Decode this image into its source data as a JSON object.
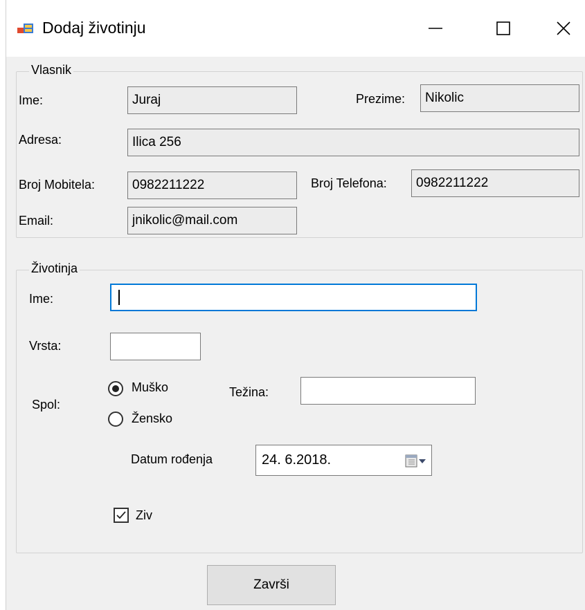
{
  "window": {
    "title": "Dodaj životinju",
    "icon": "winforms-app-icon",
    "controls": {
      "minimize_icon": "minimize-icon",
      "maximize_icon": "maximize-icon",
      "close_icon": "close-icon"
    }
  },
  "owner": {
    "legend": "Vlasnik",
    "first_name_label": "Ime:",
    "first_name_value": "Juraj",
    "last_name_label": "Prezime:",
    "last_name_value": "Nikolic",
    "address_label": "Adresa:",
    "address_value": "Ilica 256",
    "mobile_label": "Broj Mobitela:",
    "mobile_value": "0982211222",
    "phone_label": "Broj Telefona:",
    "phone_value": "0982211222",
    "email_label": "Email:",
    "email_value": "jnikolic@mail.com"
  },
  "animal": {
    "legend": "Životinja",
    "name_label": "Ime:",
    "name_value": "",
    "species_label": "Vrsta:",
    "species_value": "",
    "sex_label": "Spol:",
    "sex_options": [
      {
        "label": "Muško",
        "selected": true
      },
      {
        "label": "Žensko",
        "selected": false
      }
    ],
    "weight_label": "Težina:",
    "weight_value": "",
    "birth_date_label": "Datum rođenja",
    "birth_date_value": "24.  6.2018.",
    "alive_label": "Ziv",
    "alive_checked": true
  },
  "actions": {
    "finish_label": "Završi"
  },
  "colors": {
    "focus_border": "#0078d7",
    "window_bg": "#f0f0f0",
    "readonly_bg": "#ececec"
  }
}
